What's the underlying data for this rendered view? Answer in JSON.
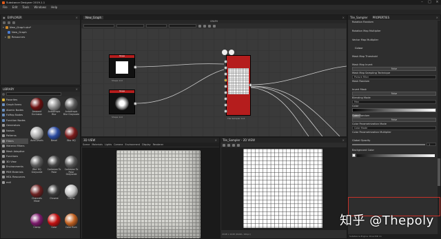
{
  "app": {
    "title": "Substance Designer 2019.1.1"
  },
  "menu": [
    "File",
    "Edit",
    "Tools",
    "Windows",
    "Help"
  ],
  "explorer": {
    "title": "EXPLORER",
    "items": [
      {
        "label": "New_Graph.sbs*"
      },
      {
        "label": "New_Graph"
      },
      {
        "label": "Resources"
      }
    ]
  },
  "graph": {
    "tab": "New_Graph",
    "subtitle": "GRAPH",
    "nodes": [
      {
        "header": "Shape",
        "caption": "Shape  1x4"
      },
      {
        "header": "Shape",
        "caption": "Shape  1x4"
      },
      {
        "header": "Tile Sampler",
        "caption": "Tile Sampler  1x4"
      }
    ]
  },
  "library": {
    "title": "LIBRARY",
    "categories": [
      {
        "label": "Favorites",
        "color": "#d8b23a"
      },
      {
        "label": "Graph Items",
        "color": "#6a8fbf"
      },
      {
        "label": "Atomic Nodes",
        "color": "#6a8fbf"
      },
      {
        "label": "FxMap Nodes",
        "color": "#6a8fbf"
      },
      {
        "label": "Function Nodes",
        "color": "#6a8fbf"
      },
      {
        "label": "Generators",
        "color": "#9a9a9a"
      },
      {
        "label": "Noises",
        "color": "#9a9a9a"
      },
      {
        "label": "Patterns",
        "color": "#9a9a9a"
      },
      {
        "label": "Filters",
        "color": "#9a9a9a"
      },
      {
        "label": "Material Filters",
        "color": "#9a9a9a"
      },
      {
        "label": "Mesh Adaptive",
        "color": "#9a9a9a"
      },
      {
        "label": "Functions",
        "color": "#9a9a9a"
      },
      {
        "label": "3D View",
        "color": "#9a9a9a"
      },
      {
        "label": "Environments",
        "color": "#9a9a9a"
      },
      {
        "label": "PBR Materials",
        "color": "#9a9a9a"
      },
      {
        "label": "MDL Resources",
        "color": "#9a9a9a"
      },
      {
        "label": "mdl",
        "color": "#9a9a9a"
      }
    ],
    "thumbs": [
      {
        "label": "Ambient Occlusion",
        "color": "#6b0f0f"
      },
      {
        "label": "Anisotropic Blur",
        "color": "#8a8a8a"
      },
      {
        "label": "Anisotropic Blur Grayscale",
        "color": "#5a5a5a"
      },
      {
        "label": "Auto Levels",
        "color": "#aaaaaa"
      },
      {
        "label": "Bevel",
        "color": "#2a4aa0"
      },
      {
        "label": "Blur HQ",
        "color": "#7a1a1a"
      },
      {
        "label": "Blur HQ Grayscale",
        "color": "#5a5a5a"
      },
      {
        "label": "Cartesian To Polar",
        "color": "#444"
      },
      {
        "label": "Cartesian To Polar Grayscale",
        "color": "#555"
      },
      {
        "label": "Channels Mixer",
        "color": "#6a2020"
      },
      {
        "label": "Chrome",
        "color": "#3a3a3a"
      },
      {
        "label": "Clamp",
        "color": "#c0c0c0"
      },
      {
        "label": "Clamp",
        "color": "#7a1a6a"
      },
      {
        "label": "Color",
        "color": "#c01010"
      },
      {
        "label": "Color Burn",
        "color": "#c06020"
      }
    ]
  },
  "view3d": {
    "title": "3D VIEW",
    "menu": [
      "Scene",
      "Materials",
      "Lights",
      "Camera",
      "Environment",
      "Display",
      "Renderer"
    ]
  },
  "view2d": {
    "title": "Tile_Sampler - 2D VIEW"
  },
  "properties": {
    "tab_node": "Tile_Sampler",
    "title": "PROPERTIES",
    "items": [
      {
        "label": "Rotation Random"
      },
      {
        "label": "Rotation Map Multiplier"
      },
      {
        "label": "Vector Map Multiplier"
      },
      {
        "label": "Colour"
      },
      {
        "label": "Mask Map Threshold"
      },
      {
        "label": "Mask Map Invert"
      },
      {
        "label": "Mask Map Sampling Technique"
      },
      {
        "label": "Mask Random"
      },
      {
        "label": "Invert Mask"
      },
      {
        "label": "Blending Mode"
      },
      {
        "label": "Color"
      },
      {
        "label": "Color Random"
      },
      {
        "label": "Color Parametrization Mode"
      },
      {
        "label": "Color Parametrization Multiplier"
      },
      {
        "label": "Global Opacity"
      },
      {
        "label": "Background Color"
      }
    ],
    "values": {
      "invert_btn": "False",
      "sampling": "Picture Filter",
      "invert_mask_btn": "False",
      "blending": "Max",
      "color_mode": "Luma",
      "color_param_mode": "Color Mode",
      "color_random_btn": "False",
      "opacity_field": "1",
      "bg_value": "0"
    }
  },
  "status": {
    "left": "2048 x 2048 (RGBA, 16bpc)",
    "right": "Substance Engine: Direct3D 11"
  },
  "watermark": "知乎 @Thepoly"
}
